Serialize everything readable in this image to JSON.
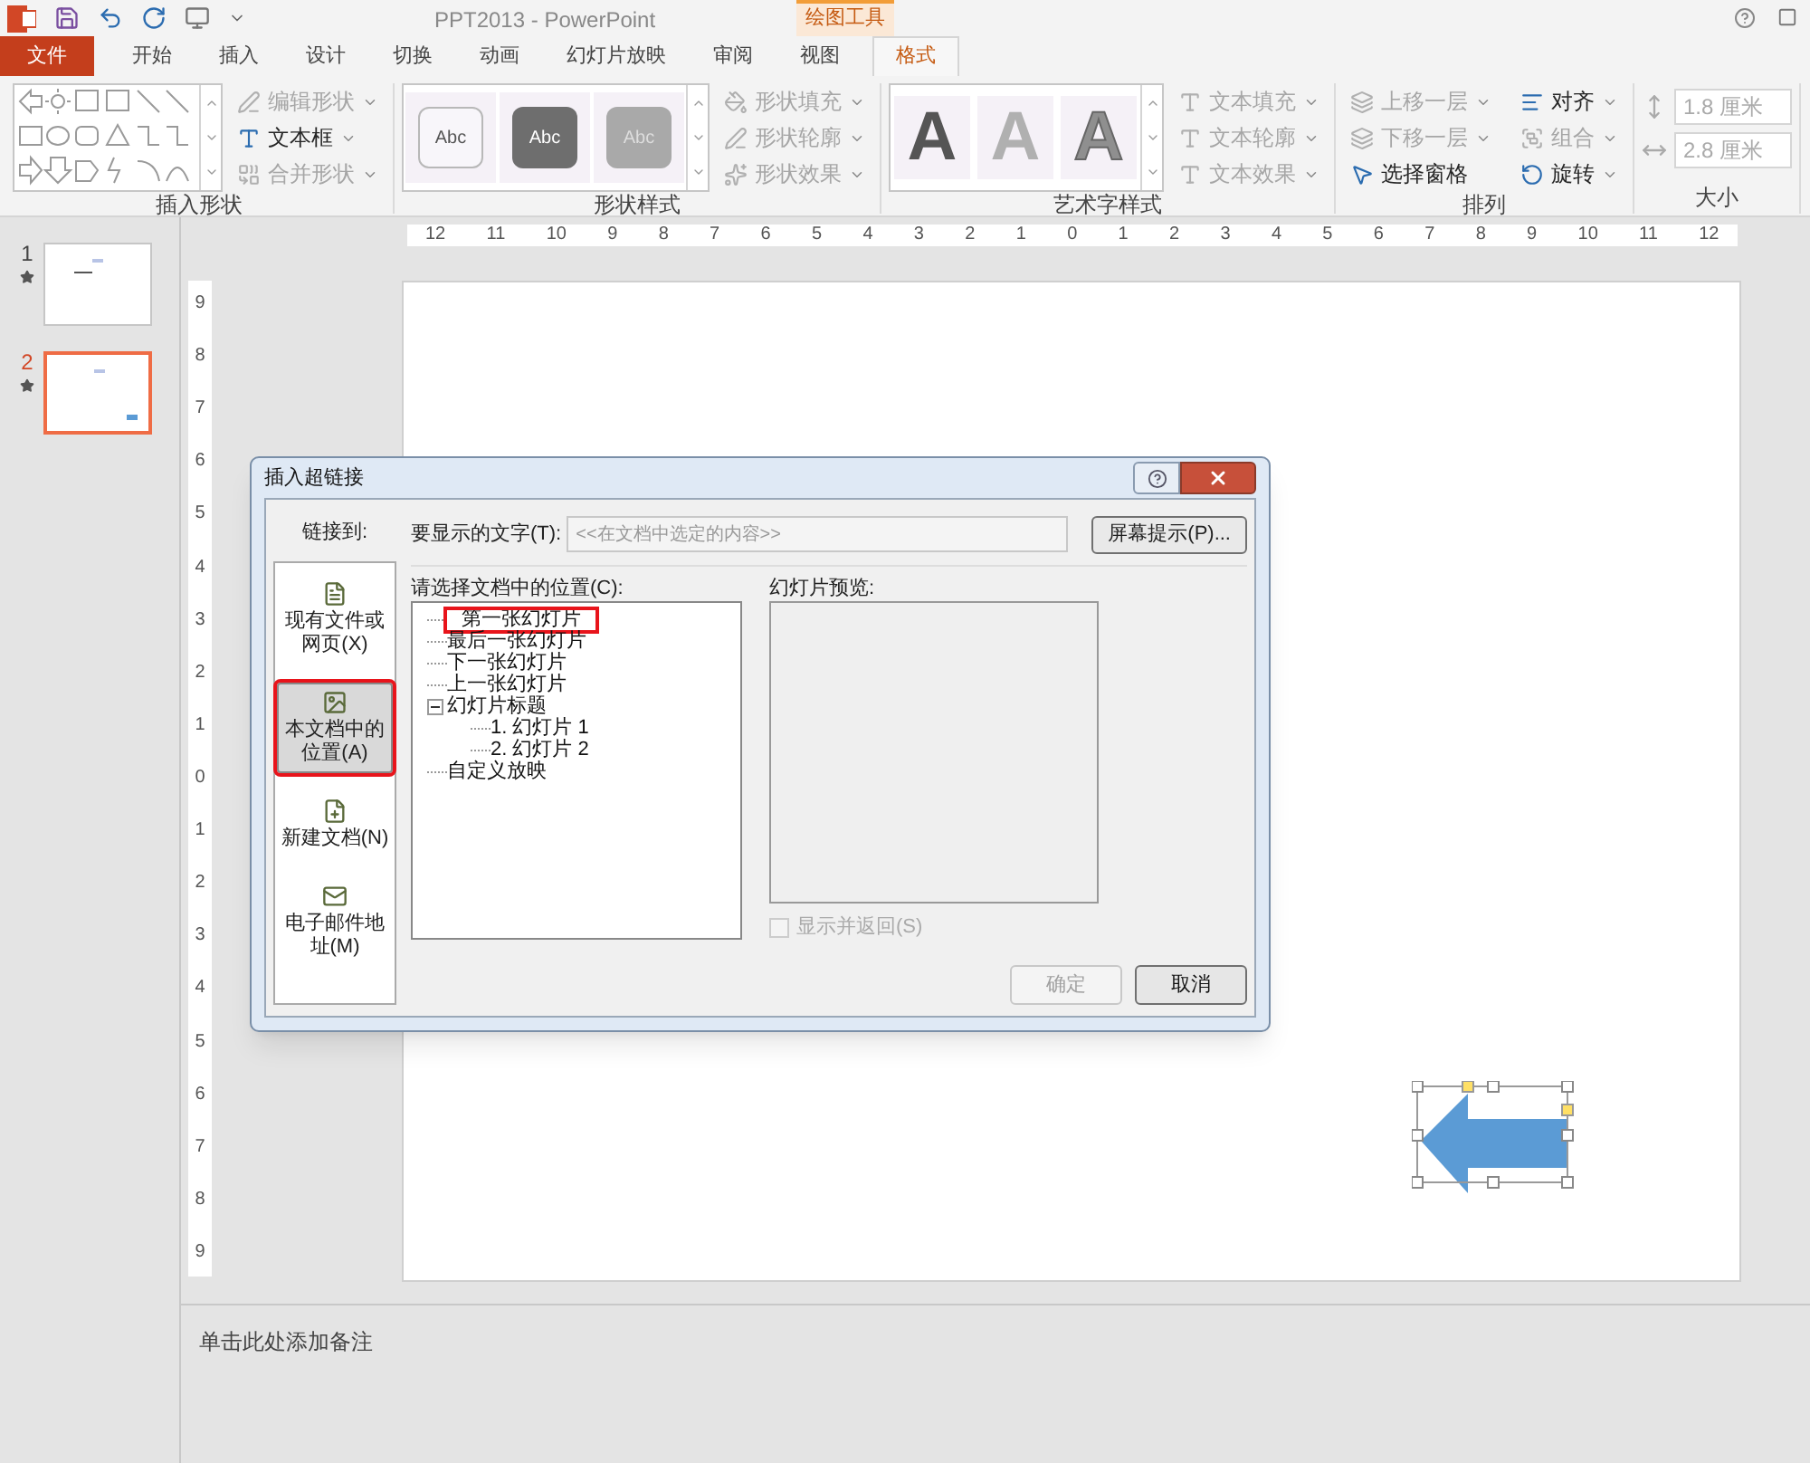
{
  "title_bar": {
    "title": "PPT2013 - PowerPoint",
    "context_label": "绘图工具"
  },
  "tabs": [
    {
      "label": "文件",
      "kind": "file",
      "selected": false
    },
    {
      "label": "开始",
      "kind": "tab",
      "selected": false
    },
    {
      "label": "插入",
      "kind": "tab",
      "selected": false
    },
    {
      "label": "设计",
      "kind": "tab",
      "selected": false
    },
    {
      "label": "切换",
      "kind": "tab",
      "selected": false
    },
    {
      "label": "动画",
      "kind": "tab",
      "selected": false
    },
    {
      "label": "幻灯片放映",
      "kind": "tab",
      "selected": false
    },
    {
      "label": "审阅",
      "kind": "tab",
      "selected": false
    },
    {
      "label": "视图",
      "kind": "tab",
      "selected": false
    },
    {
      "label": "格式",
      "kind": "context",
      "selected": true
    }
  ],
  "ribbon": {
    "groups": [
      {
        "kind": "shapes",
        "label": "插入形状",
        "commands": [
          {
            "label": "编辑形状",
            "disabled": true,
            "dropdown": true
          },
          {
            "label": "文本框",
            "disabled": false,
            "dropdown": true
          },
          {
            "label": "合并形状",
            "disabled": true,
            "dropdown": true
          }
        ]
      },
      {
        "kind": "shape_styles",
        "label": "形状样式",
        "tiles": [
          "Abc",
          "Abc",
          "Abc"
        ],
        "commands": [
          {
            "label": "形状填充",
            "disabled": true,
            "dropdown": true
          },
          {
            "label": "形状轮廓",
            "disabled": true,
            "dropdown": true
          },
          {
            "label": "形状效果",
            "disabled": true,
            "dropdown": true
          }
        ]
      },
      {
        "kind": "wordart",
        "label": "艺术字样式",
        "tiles": [
          "A",
          "A",
          "A"
        ],
        "commands": [
          {
            "label": "文本填充",
            "disabled": true,
            "dropdown": true
          },
          {
            "label": "文本轮廓",
            "disabled": true,
            "dropdown": true
          },
          {
            "label": "文本效果",
            "disabled": true,
            "dropdown": true
          }
        ]
      },
      {
        "kind": "arrange",
        "label": "排列",
        "commands": [
          {
            "label": "上移一层",
            "disabled": true,
            "dropdown": true
          },
          {
            "label": "对齐",
            "disabled": false,
            "dropdown": true
          },
          {
            "label": "下移一层",
            "disabled": true,
            "dropdown": true
          },
          {
            "label": "组合",
            "disabled": true,
            "dropdown": true
          },
          {
            "label": "选择窗格",
            "disabled": false,
            "dropdown": false
          },
          {
            "label": "旋转",
            "disabled": false,
            "dropdown": true
          }
        ]
      },
      {
        "kind": "size",
        "label": "大小",
        "fields": [
          {
            "value": "1.8 厘米",
            "disabled": true
          },
          {
            "value": "2.8 厘米",
            "disabled": true
          }
        ]
      }
    ]
  },
  "slides": [
    {
      "number": "1",
      "selected": false
    },
    {
      "number": "2",
      "selected": true
    }
  ],
  "ruler_h": [
    "12",
    "11",
    "10",
    "9",
    "8",
    "7",
    "6",
    "5",
    "4",
    "3",
    "2",
    "1",
    "0",
    "1",
    "2",
    "3",
    "4",
    "5",
    "6",
    "7",
    "8",
    "9",
    "10",
    "11",
    "12"
  ],
  "ruler_v": [
    "9",
    "8",
    "7",
    "6",
    "5",
    "4",
    "3",
    "2",
    "1",
    "0",
    "1",
    "2",
    "3",
    "4",
    "5",
    "6",
    "7",
    "8",
    "9"
  ],
  "notes": {
    "placeholder": "单击此处添加备注"
  },
  "dialog": {
    "title": "插入超链接",
    "link_to_label": "链接到:",
    "link_targets": [
      {
        "label": "现有文件或网页(X)",
        "selected": false,
        "highlighted": false
      },
      {
        "label": "本文档中的位置(A)",
        "selected": true,
        "highlighted": true
      },
      {
        "label": "新建文档(N)",
        "selected": false,
        "highlighted": false
      },
      {
        "label": "电子邮件地址(M)",
        "selected": false,
        "highlighted": false
      }
    ],
    "display_text": {
      "label": "要显示的文字(T):",
      "value": "<<在文档中选定的内容>>",
      "disabled": true
    },
    "screentip_button": "屏幕提示(P)...",
    "location_label": "请选择文档中的位置(C):",
    "locations": [
      {
        "label": "第一张幻灯片",
        "highlighted": true
      },
      {
        "label": "最后一张幻灯片",
        "highlighted": false
      },
      {
        "label": "下一张幻灯片",
        "highlighted": false
      },
      {
        "label": "上一张幻灯片",
        "highlighted": false
      },
      {
        "label": "幻灯片标题",
        "highlighted": false,
        "expanded": true,
        "children": [
          {
            "label": "1. 幻灯片 1",
            "highlighted": false
          },
          {
            "label": "2. 幻灯片 2",
            "highlighted": false
          }
        ]
      },
      {
        "label": "自定义放映",
        "highlighted": false
      }
    ],
    "preview_label": "幻灯片预览:",
    "show_and_return": {
      "label": "显示并返回(S)",
      "checked": false,
      "disabled": true
    },
    "buttons": [
      {
        "label": "确定",
        "disabled": true
      },
      {
        "label": "取消",
        "disabled": false
      }
    ]
  }
}
